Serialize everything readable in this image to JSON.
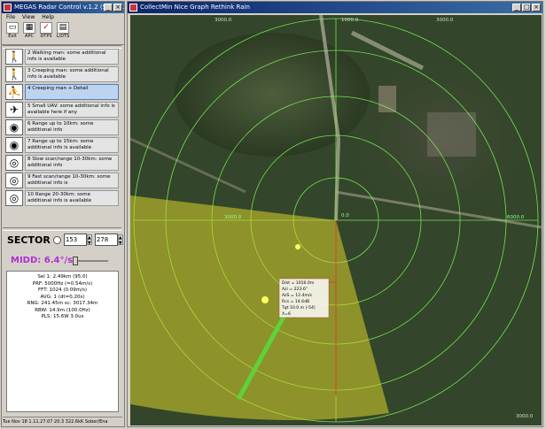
{
  "control": {
    "title": "MEGAS Radar Control v.1.2 (S/N 113 .113858-218)",
    "menu": [
      "File",
      "View",
      "Help"
    ],
    "toolbar": [
      {
        "label": "Exit",
        "icon": "exit-icon"
      },
      {
        "label": "APC",
        "icon": "apc-icon"
      },
      {
        "label": "DTPS",
        "icon": "check-icon"
      },
      {
        "label": "L/DTS",
        "icon": "dts-icon"
      }
    ],
    "modes": [
      {
        "text": "2 Walking man: some additional info is available",
        "icon": "walking-man-icon",
        "glyph": "🚶"
      },
      {
        "text": "3 Creeping man: some additional info is available",
        "icon": "creeping-man-icon",
        "glyph": "🚶"
      },
      {
        "text": "4 Creeping man + Detail",
        "icon": "creeping-detail-icon",
        "glyph": "⛹"
      },
      {
        "text": "5 Small UAV: some additional info is available here if any",
        "icon": "uav-icon",
        "glyph": "✈"
      },
      {
        "text": "6 Range up to 10km: some additional info",
        "icon": "range-10-icon",
        "glyph": "◉"
      },
      {
        "text": "7 Range up to 15km: some additional info is available",
        "icon": "range-15-icon",
        "glyph": "◉"
      },
      {
        "text": "8 Slow scan/range 10-30km: some additional info",
        "icon": "slow-scan-icon",
        "glyph": "◎"
      },
      {
        "text": "9 Fast scan/range 10-30km: some additional info is",
        "icon": "fast-scan-icon",
        "glyph": "◎"
      },
      {
        "text": "10 Range 20-30km: some additional info is available",
        "icon": "range-30-icon",
        "glyph": "◎"
      }
    ],
    "sector_label": "SECTOR",
    "sector_from": "153",
    "sector_to": "278",
    "midd_label": "MIDD: 6.4°/s",
    "slider_fraction": 0,
    "info_lines": [
      "Sel 1: 2.49km (95.0)",
      "PRF: 5000Hz (=0.54m/s)",
      "FFT: 1024 (0.09m/s)",
      "AVG: 1 (dt=0.20s)",
      "RNG: 241.45m sc: 3017.34m",
      "RBW: 14.9m (100.0Hz)",
      "PLS: 15.6W 3.0us"
    ],
    "status_text": "Tue Nov 18 1.11.27.07 20.3 322.6kK Sober/Ena"
  },
  "map": {
    "title": "CollectMin Nice Graph Rethink Rain",
    "range_labels": {
      "top_left": "3000.0",
      "top_mid": "1000.0",
      "top_right": "3000.0",
      "bottom_right": "3000.0",
      "right": "6000.0",
      "center": "0.0",
      "left_ring": "3000.0"
    },
    "readout": [
      "Dist = 1016.0m",
      "Azi = 223.6°",
      "AzS = 12.4m/s",
      "Rcs = 14.6dB",
      "Tgt 10.0 m (-54)",
      "X=6"
    ],
    "colors": {
      "sector": "#d7d22a",
      "ring": "#7fff5a",
      "cursor": "#e04030",
      "track": "#5fd23a"
    }
  }
}
